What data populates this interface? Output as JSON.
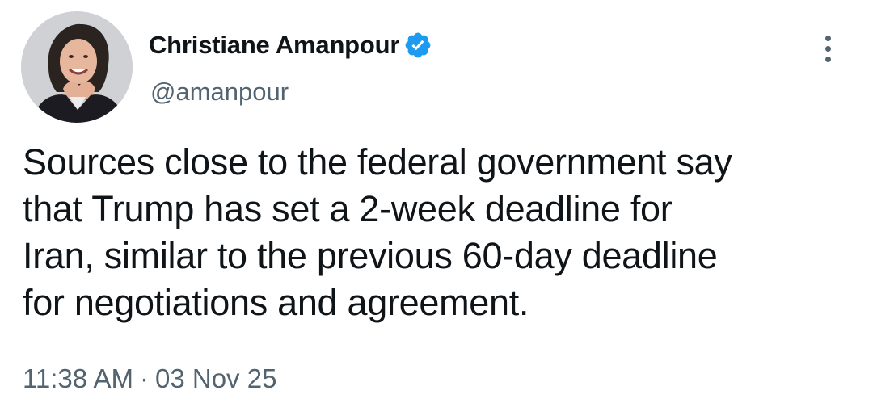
{
  "author": {
    "display_name": "Christiane Amanpour",
    "handle": "@amanpour",
    "verified": true
  },
  "tweet": {
    "text_lines": [
      "Sources close to the federal government say",
      "that Trump has set a 2-week deadline for",
      "Iran, similar to the previous 60-day deadline",
      "for negotiations and agreement."
    ],
    "time": "11:38 AM",
    "separator": "·",
    "date": "03 Nov 25"
  },
  "icons": {
    "verified": "verified-badge-icon",
    "more": "more-options-icon"
  },
  "colors": {
    "text_primary": "#0f1419",
    "text_secondary": "#536471",
    "verified_blue": "#1d9bf0",
    "background": "#ffffff"
  }
}
